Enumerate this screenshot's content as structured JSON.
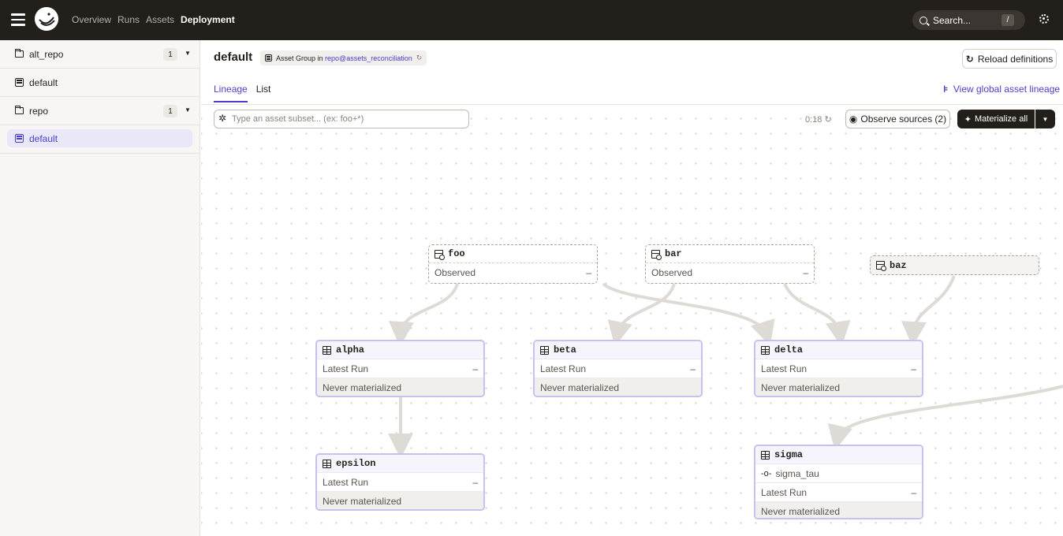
{
  "topbar": {
    "nav": [
      "Overview",
      "Runs",
      "Assets",
      "Deployment"
    ],
    "active_nav": "Deployment",
    "search_placeholder": "Search...",
    "search_shortcut": "/"
  },
  "sidebar": {
    "items": [
      {
        "label": "alt_repo",
        "count": "1",
        "type": "repo"
      },
      {
        "label": "default",
        "type": "group"
      },
      {
        "label": "repo",
        "count": "1",
        "type": "repo"
      },
      {
        "label": "default",
        "type": "group",
        "selected": true
      }
    ]
  },
  "header": {
    "title": "default",
    "subtitle_prefix": "Asset Group in",
    "subtitle_link": "repo@assets_reconciliation",
    "reload_label": "Reload definitions",
    "tabs": [
      "Lineage",
      "List"
    ],
    "active_tab": "Lineage",
    "global_lineage_label": "View global asset lineage"
  },
  "toolbar": {
    "filter_placeholder": "Type an asset subset... (ex: foo+*)",
    "refresh_time": "0:18",
    "observe_label": "Observe sources (2)",
    "materialize_label": "Materialize all"
  },
  "graph": {
    "sources": [
      {
        "name": "foo",
        "status": "Observed",
        "value": "–"
      },
      {
        "name": "bar",
        "status": "Observed",
        "value": "–"
      },
      {
        "name": "baz"
      }
    ],
    "assets": [
      {
        "name": "alpha",
        "run_label": "Latest Run",
        "run_value": "–",
        "state": "Never materialized"
      },
      {
        "name": "beta",
        "run_label": "Latest Run",
        "run_value": "–",
        "state": "Never materialized"
      },
      {
        "name": "delta",
        "run_label": "Latest Run",
        "run_value": "–",
        "state": "Never materialized"
      },
      {
        "name": "epsilon",
        "run_label": "Latest Run",
        "run_value": "–",
        "state": "Never materialized"
      },
      {
        "name": "sigma",
        "check": "sigma_tau",
        "run_label": "Latest Run",
        "run_value": "–",
        "state": "Never materialized"
      }
    ]
  },
  "colors": {
    "accent": "#4e3ccf",
    "topbar": "#231f1b",
    "node_border": "#c9c0f0"
  }
}
